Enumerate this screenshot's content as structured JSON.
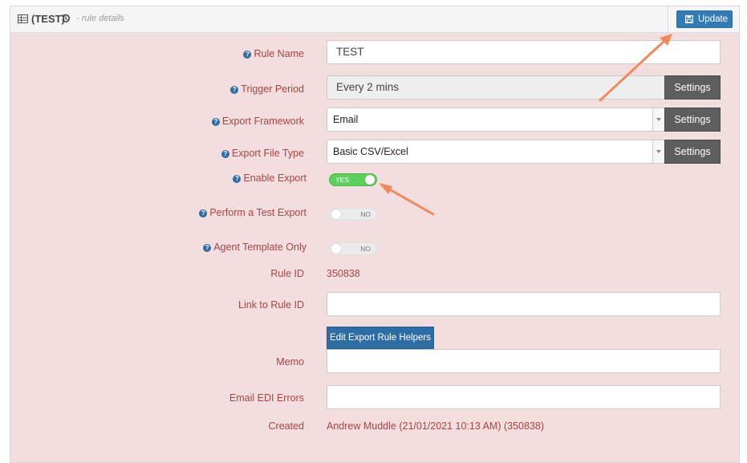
{
  "header": {
    "title": "(TEST)",
    "subtitle": "- rule details",
    "update_label": "Update"
  },
  "form": {
    "rule_name": {
      "label": "Rule Name",
      "value": "TEST"
    },
    "trigger_period": {
      "label": "Trigger Period",
      "value": "Every 2 mins",
      "settings_label": "Settings"
    },
    "export_framework": {
      "label": "Export Framework",
      "value": "Email",
      "settings_label": "Settings"
    },
    "export_file_type": {
      "label": "Export File Type",
      "value": "Basic CSV/Excel",
      "settings_label": "Settings"
    },
    "enable_export": {
      "label": "Enable Export",
      "state": "YES"
    },
    "test_export": {
      "label": "Perform a Test Export",
      "state": "NO"
    },
    "agent_template": {
      "label": "Agent Template Only",
      "state": "NO"
    },
    "rule_id": {
      "label": "Rule ID",
      "value": "350838"
    },
    "link_rule_id": {
      "label": "Link to Rule ID",
      "value": ""
    },
    "helpers_button": "Edit Export Rule Helpers",
    "memo": {
      "label": "Memo",
      "value": ""
    },
    "email_edi_errors": {
      "label": "Email EDI Errors",
      "value": ""
    },
    "created": {
      "label": "Created",
      "value": "Andrew Muddle (21/01/2021 10:13 AM) (350838)"
    }
  },
  "colors": {
    "panel_bg": "#f2dede",
    "label_text": "#a94442",
    "primary": "#337ab7",
    "toggle_on": "#5cd05c",
    "annotation_arrow": "#f08a5d"
  }
}
